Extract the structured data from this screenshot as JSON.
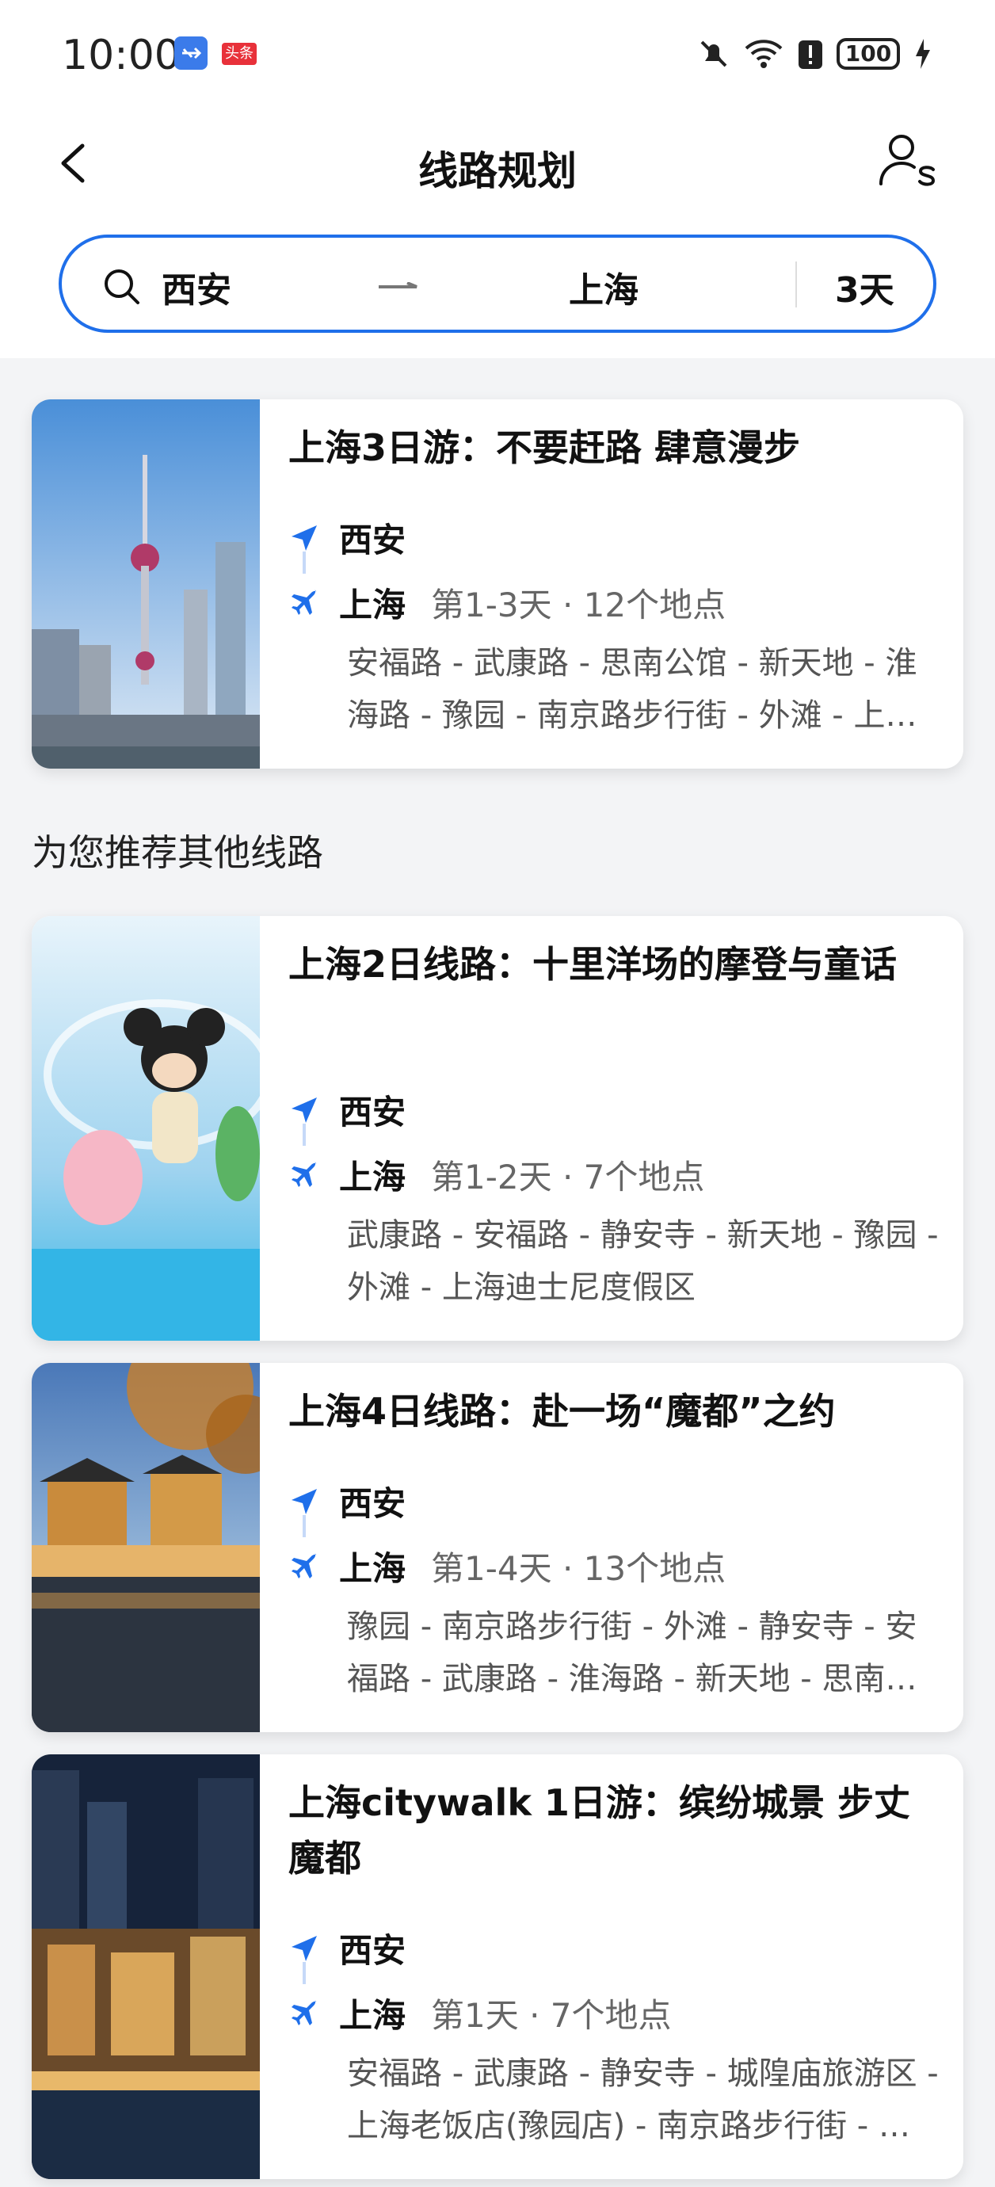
{
  "status_bar": {
    "time": "10:00",
    "news_badge": "头条",
    "battery": "100"
  },
  "header": {
    "title": "线路规划"
  },
  "search": {
    "from": "西安",
    "to": "上海",
    "days": "3天"
  },
  "section_title": "为您推荐其他线路",
  "colors": {
    "accent": "#1f6fea",
    "route_text": "#555555"
  },
  "cards": [
    {
      "title": "上海3日游：不要赶路 肆意漫步",
      "origin": "西安",
      "destination": "上海",
      "meta": "第1-3天 · 12个地点",
      "route": "安福路 - 武康路 - 思南公馆 - 新天地 - 淮海路 - 豫园 - 南京路步行街 - 外滩 - 上海迪士尼度假区"
    },
    {
      "title": "上海2日线路：十里洋场的摩登与童话",
      "origin": "西安",
      "destination": "上海",
      "meta": "第1-2天 · 7个地点",
      "route": "武康路 - 安福路 - 静安寺 - 新天地 - 豫园 - 外滩 - 上海迪士尼度假区"
    },
    {
      "title": "上海4日线路：赴一场“魔都”之约",
      "origin": "西安",
      "destination": "上海",
      "meta": "第1-4天 · 13个地点",
      "route": "豫园 - 南京路步行街 - 外滩 - 静安寺 - 安福路 - 武康路 - 淮海路 - 新天地 - 思南公馆"
    },
    {
      "title": "上海citywalk 1日游：缤纷城景 步丈魔都",
      "origin": "西安",
      "destination": "上海",
      "meta": "第1天 · 7个地点",
      "route": "安福路 - 武康路 - 静安寺 - 城隍庙旅游区 - 上海老饭店(豫园店) - 南京路步行街 - 外滩"
    }
  ]
}
